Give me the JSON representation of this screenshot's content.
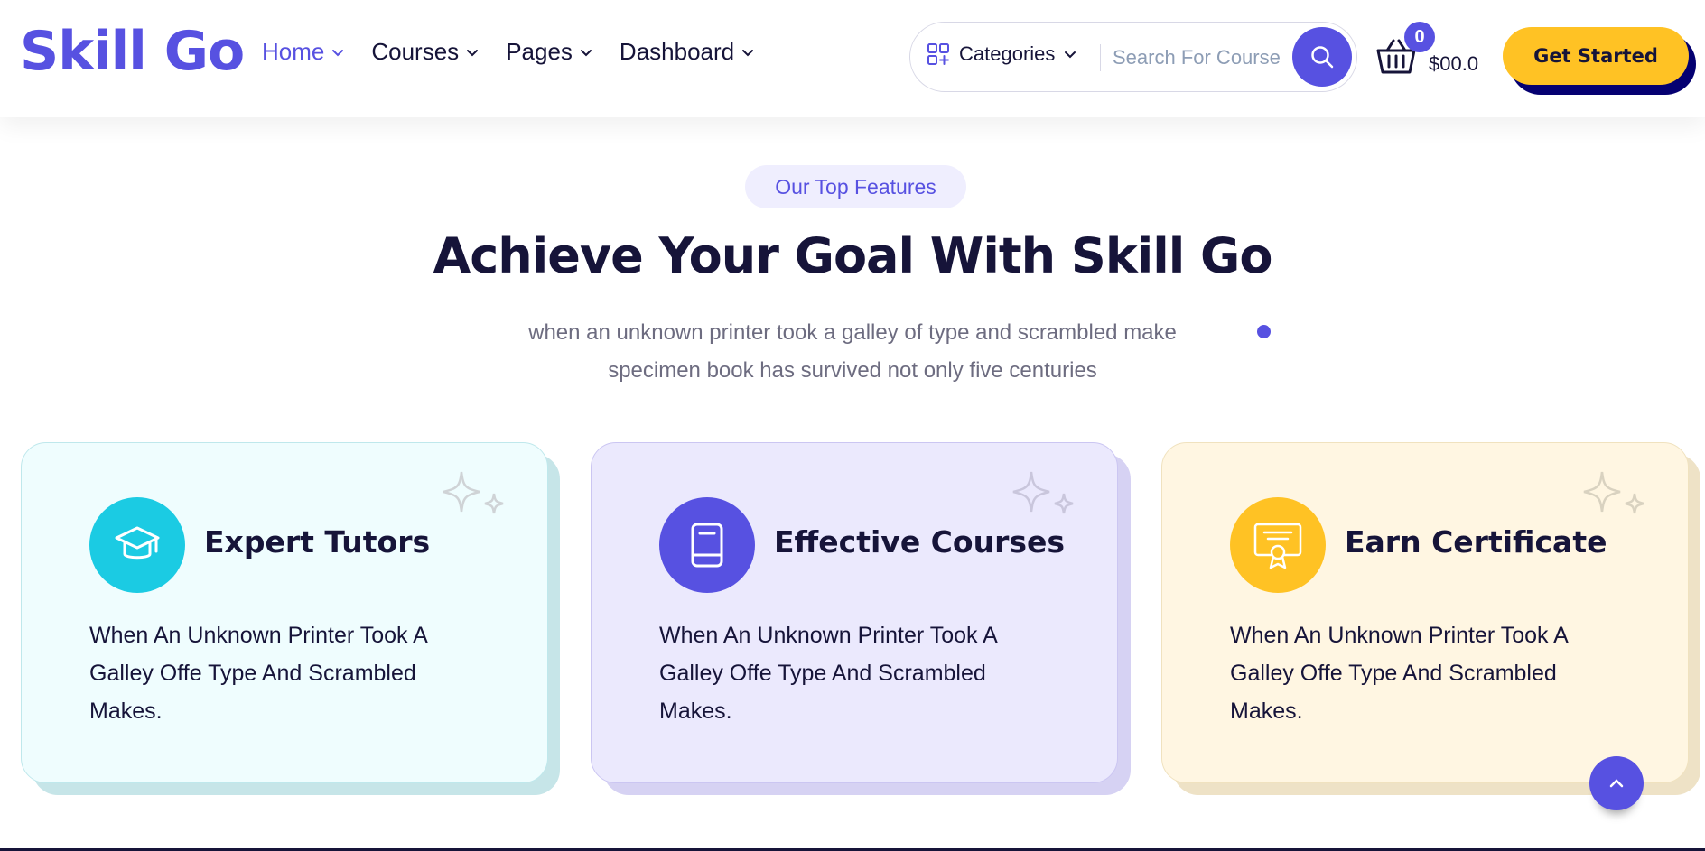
{
  "brand": {
    "logo": "Skill Go",
    "accent": "#5751e1",
    "dark": "#161439",
    "yellow": "#ffc224"
  },
  "nav": {
    "items": [
      {
        "label": "Home",
        "active": true
      },
      {
        "label": "Courses"
      },
      {
        "label": "Pages"
      },
      {
        "label": "Dashboard"
      }
    ]
  },
  "search": {
    "category_label": "Categories",
    "placeholder": "Search For Course",
    "icon": "search-icon"
  },
  "cart": {
    "count": "0",
    "total": "$00.0",
    "icon": "basket-icon"
  },
  "cta": {
    "label": "Get Started"
  },
  "section": {
    "badge": "Our Top Features",
    "title": "Achieve Your Goal With Skill Go",
    "subtitle_line1": "when an unknown printer took a galley of type and scrambled make",
    "subtitle_line2": "specimen book has survived not only five centuries"
  },
  "features": [
    {
      "title": "Expert Tutors",
      "text": "When An Unknown Printer Took A Galley Offe Type And Scrambled Makes.",
      "icon": "graduation-cap-icon",
      "icon_bg": "#1bcbe3",
      "card_bg": "#effdfe",
      "card_border": "#bfe8ec",
      "back_bg": "#c6e5e8"
    },
    {
      "title": "Effective Courses",
      "text": "When An Unknown Printer Took A Galley Offe Type And Scrambled Makes.",
      "icon": "book-icon",
      "icon_bg": "#5751e1",
      "card_bg": "#ebe9fd",
      "card_border": "#cbc6f2",
      "back_bg": "#d6d2f3"
    },
    {
      "title": "Earn Certificate",
      "text": "When An Unknown Printer Took A Galley Offe Type And Scrambled Makes.",
      "icon": "certificate-icon",
      "icon_bg": "#ffc224",
      "card_bg": "#fff6e2",
      "card_border": "#f0e2bf",
      "back_bg": "#eee2c6"
    }
  ],
  "scroll_top": {
    "icon": "chevron-up-icon"
  }
}
